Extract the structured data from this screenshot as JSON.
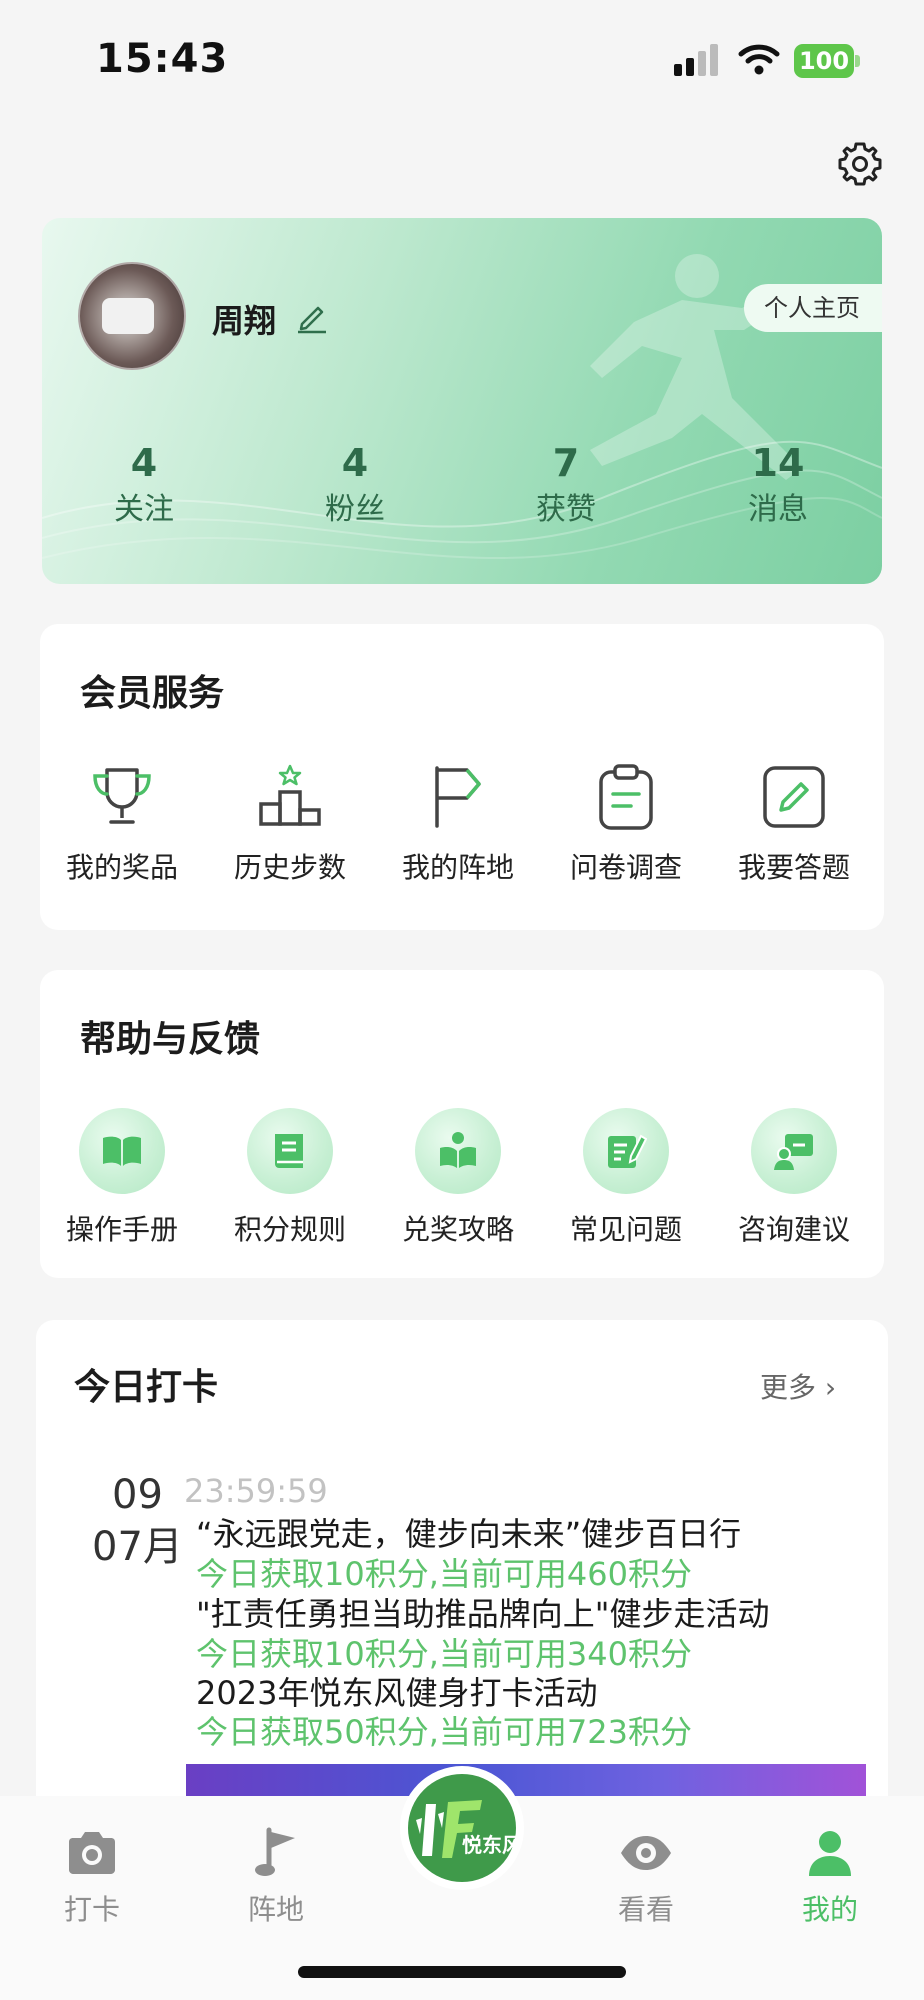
{
  "status_bar": {
    "time": "15:43",
    "battery": "100"
  },
  "profile": {
    "name": "周翔",
    "homepage_button": "个人主页",
    "stats": [
      {
        "value": "4",
        "label": "关注"
      },
      {
        "value": "4",
        "label": "粉丝"
      },
      {
        "value": "7",
        "label": "获赞"
      },
      {
        "value": "14",
        "label": "消息"
      }
    ]
  },
  "member_services": {
    "title": "会员服务",
    "items": [
      {
        "label": "我的奖品",
        "icon": "trophy-icon"
      },
      {
        "label": "历史步数",
        "icon": "podium-icon"
      },
      {
        "label": "我的阵地",
        "icon": "flag-icon"
      },
      {
        "label": "问卷调查",
        "icon": "clipboard-icon"
      },
      {
        "label": "我要答题",
        "icon": "pencil-square-icon"
      }
    ]
  },
  "help_feedback": {
    "title": "帮助与反馈",
    "items": [
      {
        "label": "操作手册",
        "icon": "open-book-icon"
      },
      {
        "label": "积分规则",
        "icon": "book-icon"
      },
      {
        "label": "兑奖攻略",
        "icon": "reader-icon"
      },
      {
        "label": "常见问题",
        "icon": "note-edit-icon"
      },
      {
        "label": "咨询建议",
        "icon": "consult-icon"
      }
    ]
  },
  "today_checkin": {
    "title": "今日打卡",
    "more": "更多",
    "date_day": "09",
    "date_month": "07月",
    "time": "23:59:59",
    "lines": [
      {
        "text": "“永远跟党走，健步向未来”健步百日行",
        "kind": "activity"
      },
      {
        "text": "今日获取10积分,当前可用460积分",
        "kind": "points"
      },
      {
        "text": "\"扛责任勇担当助推品牌向上\"健步走活动",
        "kind": "activity"
      },
      {
        "text": "今日获取10积分,当前可用340积分",
        "kind": "points"
      },
      {
        "text": "2023年悦东风健身打卡活动",
        "kind": "activity"
      },
      {
        "text": "今日获取50积分,当前可用723积分",
        "kind": "points"
      }
    ]
  },
  "tab_bar": {
    "tabs": [
      {
        "label": "打卡",
        "icon": "camera-icon"
      },
      {
        "label": "阵地",
        "icon": "flag-pin-icon"
      },
      {
        "label": "看看",
        "icon": "eye-icon"
      },
      {
        "label": "我的",
        "icon": "person-icon"
      }
    ],
    "center_logo_text": "悦东风"
  },
  "colors": {
    "accent_green": "#4cbf67",
    "points_green": "#5ec36d",
    "card_green": "#7ccfa2"
  }
}
